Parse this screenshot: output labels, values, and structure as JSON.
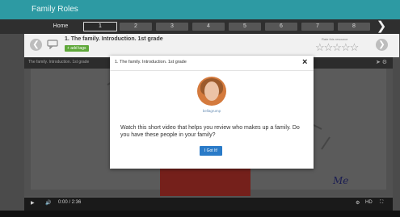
{
  "app": {
    "title": "Family Roles"
  },
  "nav": {
    "home_label": "Home",
    "pages": [
      "1",
      "2",
      "3",
      "4",
      "5",
      "6",
      "7",
      "8"
    ],
    "active_index": 0
  },
  "lesson": {
    "title": "1. The family. Introduction. 1st grade",
    "add_tags_label": "+ add tags",
    "rate_label": "Rate this resource",
    "stars": "☆☆☆☆☆"
  },
  "video": {
    "title": "The family. Introduction. 1st grade",
    "handwriting": "Me",
    "time": "0:00 / 2:36"
  },
  "modal": {
    "title": "1. The family. Introduction. 1st grade",
    "close": "×",
    "author": "bellagrump",
    "body": "Watch this short video that helps you review who makes up a family. Do you have these people in your family?",
    "button_label": "I Got It!"
  },
  "colors": {
    "title_bar": "#2d9aa3",
    "add_tags": "#5fa83a",
    "button": "#2a7bc8"
  }
}
